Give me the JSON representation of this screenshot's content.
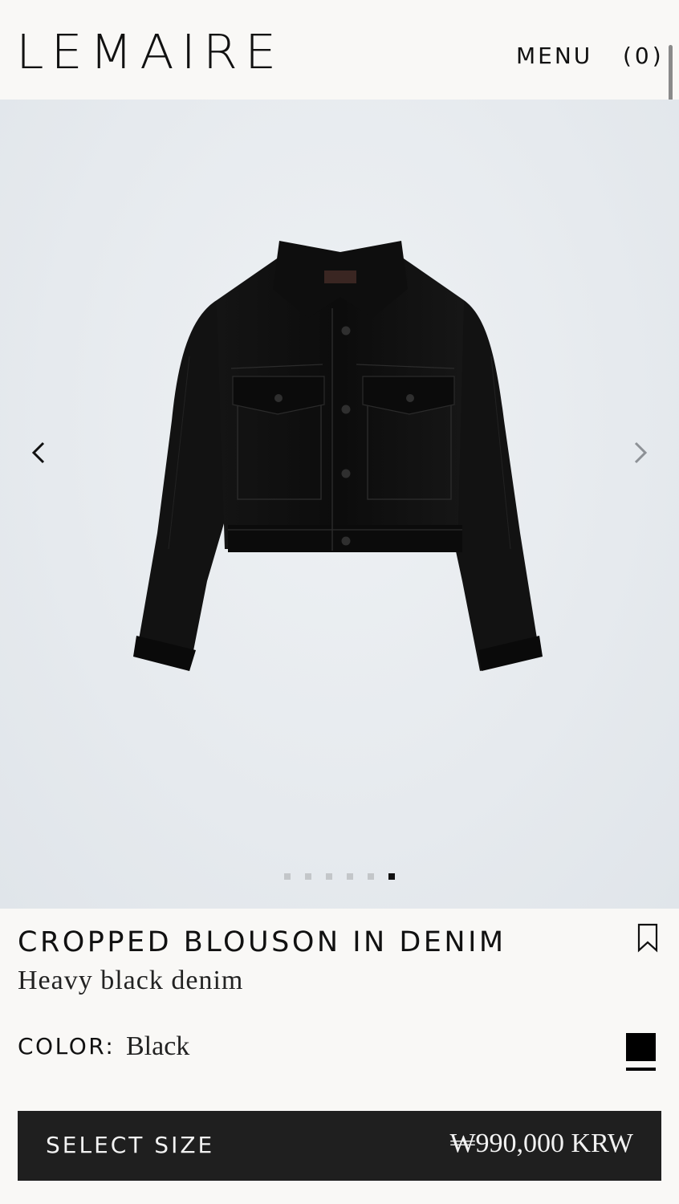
{
  "header": {
    "logo": "LEMAIRE",
    "menu_label": "MENU",
    "cart_label": "(0)"
  },
  "gallery": {
    "image": "black-denim-cropped-jacket",
    "prev_icon": "chevron-left-icon",
    "next_icon": "chevron-right-icon",
    "slide_count": 6,
    "active_slide": 6
  },
  "product": {
    "name": "CROPPED BLOUSON IN DENIM",
    "material": "Heavy black denim",
    "color_label": "COLOR:",
    "color_value": "Black",
    "swatch_color": "#000000",
    "bookmark_icon": "bookmark-icon"
  },
  "purchase": {
    "select_size_label": "SELECT SIZE",
    "price": "₩990,000 KRW"
  },
  "colors": {
    "background": "#f9f8f6",
    "button": "#1f1f1f",
    "text": "#111111"
  }
}
